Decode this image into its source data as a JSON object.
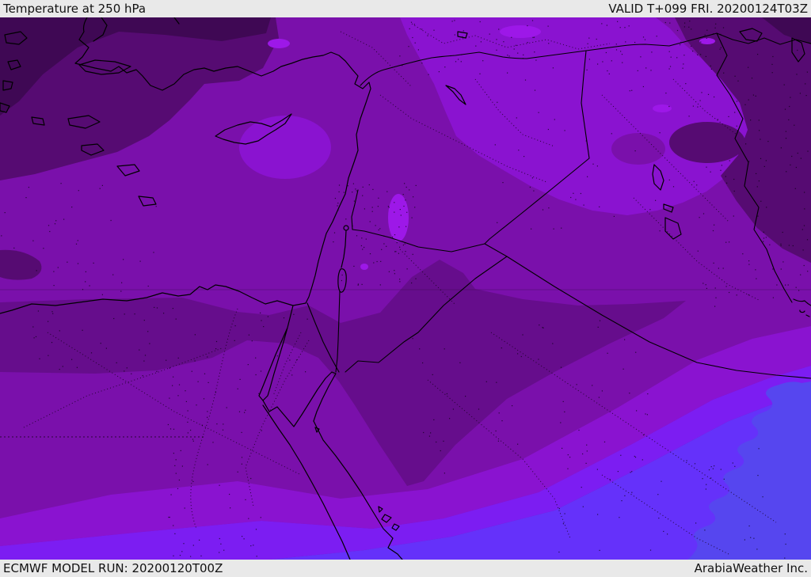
{
  "header": {
    "title": "Temperature at 250 hPa",
    "validity": "VALID T+099 FRI. 20200124T03Z"
  },
  "footer": {
    "model_run": "ECMWF MODEL RUN: 20200120T00Z",
    "credit": "ArabiaWeather Inc."
  },
  "map": {
    "kind": "filled contour temperature map",
    "parameter": "Temperature at 250 hPa",
    "region": "Eastern Mediterranean and Middle East (Turkey, Cyprus, Levant, Egypt, Sinai, Red Sea, Iraq, northern Saudi Arabia)",
    "gradient_note": "darkest/coldest shading over the northwest (Aegean, western Turkey, northern Egypt), progressively brighter violet and blue-violet bands toward the southeast",
    "palette": {
      "darkest": "#3f0854",
      "dark": "#560b72",
      "med_dark": "#660d8c",
      "medium": "#7a10ab",
      "med_bright": "#8a13d0",
      "bright_spot": "#9d18e8",
      "violet": "#7c1df2",
      "blue_violet": "#6531fa",
      "blue": "#5646ef",
      "outline": "#000000",
      "bar_bg": "#e9e9e9",
      "bar_fg": "#121212"
    },
    "bands_order": [
      "darkest",
      "dark",
      "med_dark",
      "medium",
      "med_bright",
      "violet",
      "blue_violet",
      "blue"
    ]
  }
}
